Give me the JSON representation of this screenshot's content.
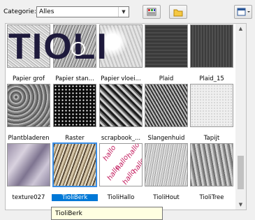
{
  "toolbar": {
    "category_label": "Categorie:",
    "category_value": "Alles",
    "icons": [
      "thumbnail-list-icon",
      "folder-icon",
      "view-menu-icon"
    ]
  },
  "watermark": "TIOLI",
  "tiles": [
    {
      "label": "Papier grof"
    },
    {
      "label": "Papier stan..."
    },
    {
      "label": "Papier vloei..."
    },
    {
      "label": "Plaid"
    },
    {
      "label": "Plaid_15"
    },
    {
      "label": "Plantbladeren"
    },
    {
      "label": "Raster"
    },
    {
      "label": "scrapbook_..."
    },
    {
      "label": "Slangenhuid"
    },
    {
      "label": "Tapijt"
    },
    {
      "label": "texture027"
    },
    {
      "label": "TioliBerk"
    },
    {
      "label": "TioliHallo"
    },
    {
      "label": "TioliHout"
    },
    {
      "label": "TioliTree"
    }
  ],
  "selected_tile": "TioliBerk",
  "tooltip": "TioliBerk",
  "colors": {
    "selection": "#0078d7",
    "hallo_pink": "#c2185b"
  }
}
